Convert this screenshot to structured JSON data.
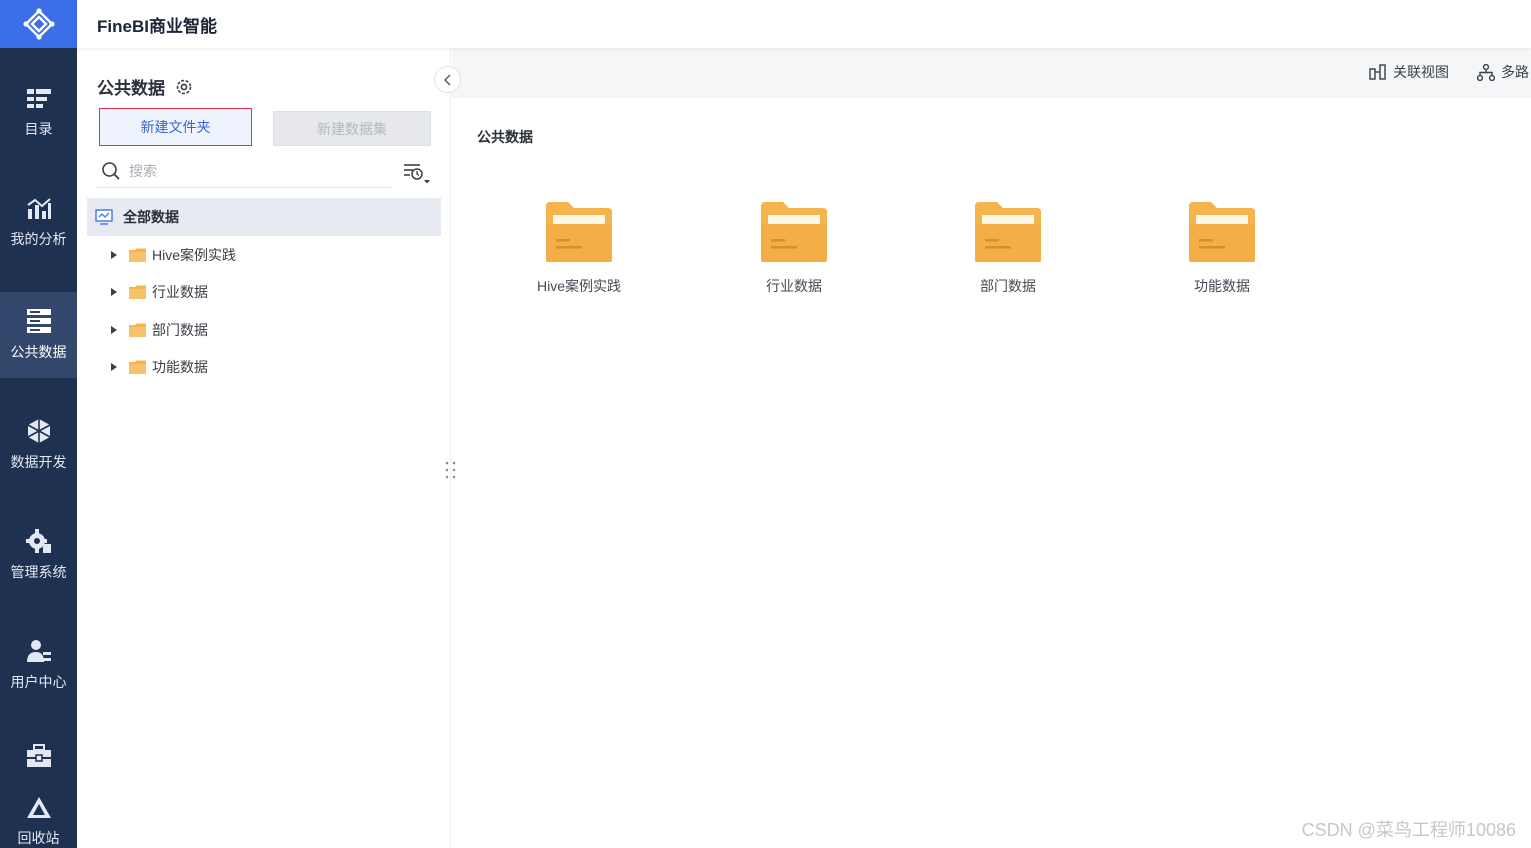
{
  "header": {
    "app_title": "FineBI商业智能"
  },
  "nav": {
    "items": [
      {
        "label": "目录",
        "icon": "list-icon"
      },
      {
        "label": "我的分析",
        "icon": "chart-icon"
      },
      {
        "label": "公共数据",
        "icon": "database-icon",
        "active": true
      },
      {
        "label": "数据开发",
        "icon": "cube-icon"
      },
      {
        "label": "管理系统",
        "icon": "gear-icon"
      },
      {
        "label": "用户中心",
        "icon": "user-icon"
      },
      {
        "label": "",
        "icon": "toolbox-icon"
      },
      {
        "label": "回收站",
        "icon": "recycle-icon"
      }
    ]
  },
  "panel": {
    "title": "公共数据",
    "new_folder_label": "新建文件夹",
    "new_dataset_label": "新建数据集",
    "search_placeholder": "搜索",
    "tree": {
      "root_label": "全部数据",
      "items": [
        "Hive案例实践",
        "行业数据",
        "部门数据",
        "功能数据"
      ]
    }
  },
  "main": {
    "toolbar": {
      "relation_view": "关联视图",
      "multi_path": "多路"
    },
    "breadcrumb": "公共数据",
    "folders": [
      "Hive案例实践",
      "行业数据",
      "部门数据",
      "功能数据"
    ]
  },
  "watermark": "CSDN @菜鸟工程师10086",
  "colors": {
    "nav_bg": "#1f3150",
    "nav_active": "#32476b",
    "logo_bg": "#3c6ee8",
    "accent_blue": "#3567d8",
    "folder_yellow": "#f5b44c"
  }
}
